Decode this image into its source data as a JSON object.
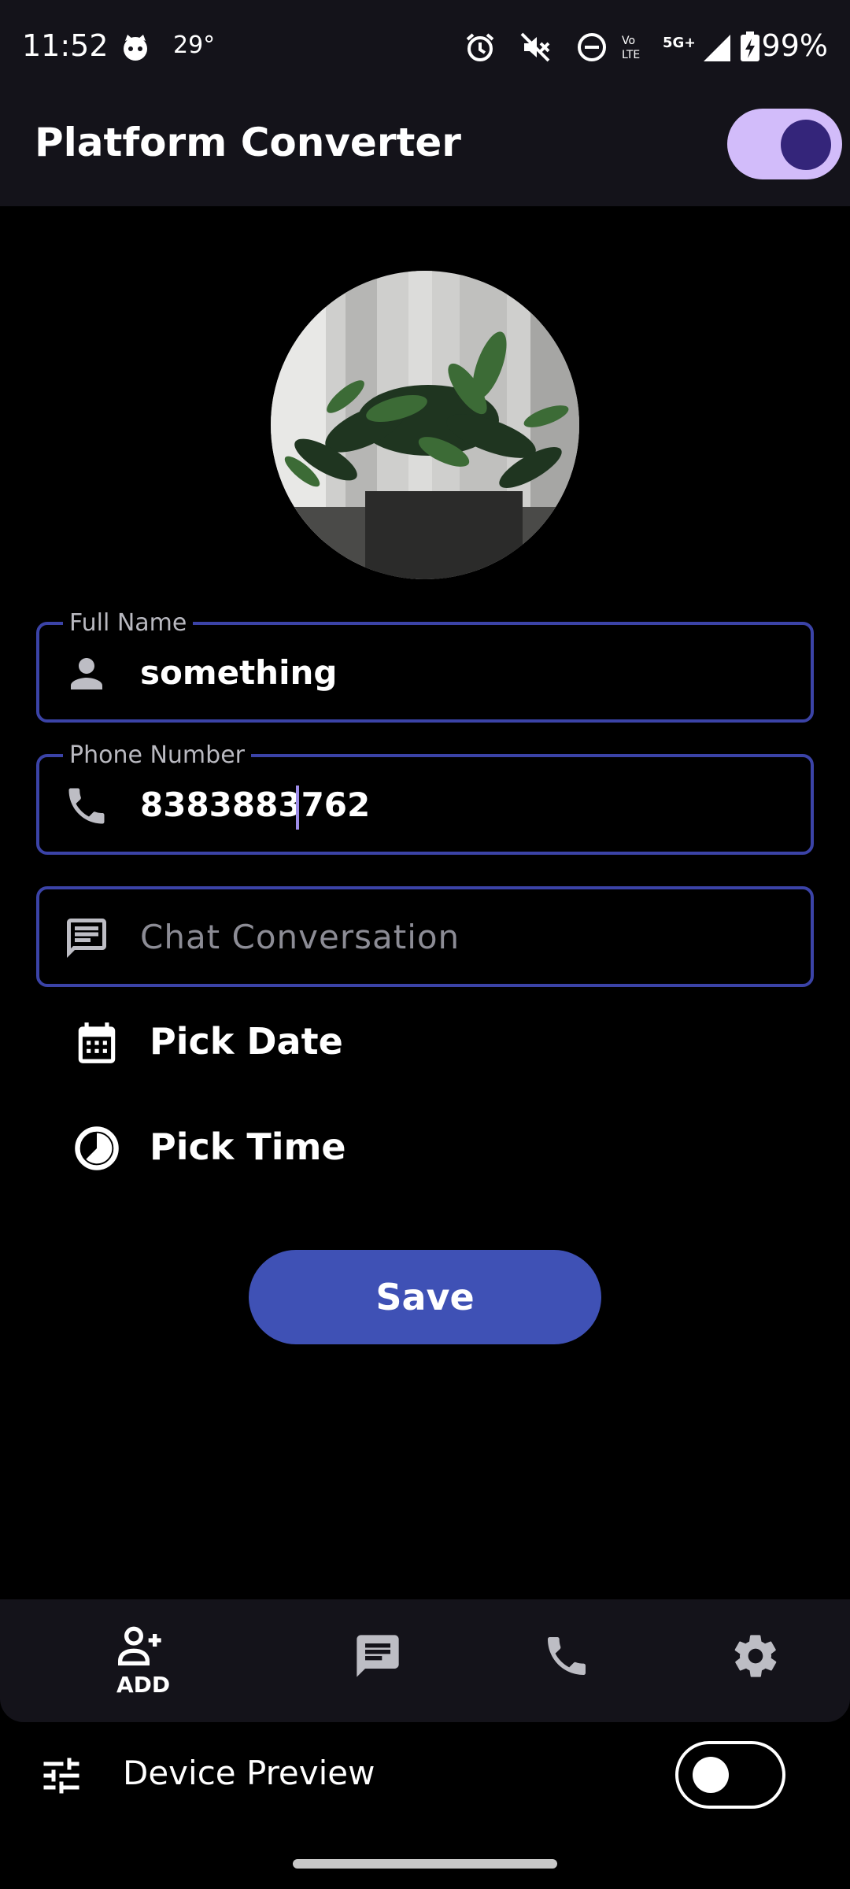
{
  "status_bar": {
    "time": "11:52",
    "temperature": "29°",
    "battery": "99%",
    "icons": [
      "cat-face-icon",
      "alarm-icon",
      "mute-icon",
      "dnd-icon",
      "volte-icon",
      "5g-icon",
      "signal-icon",
      "battery-charging-icon"
    ]
  },
  "app_bar": {
    "title": "Platform Converter",
    "theme_toggle_on": true
  },
  "form": {
    "full_name": {
      "label": "Full Name",
      "value": "something",
      "icon": "person-icon"
    },
    "phone": {
      "label": "Phone Number",
      "value": "8383883762",
      "icon": "phone-icon"
    },
    "chat": {
      "placeholder": "Chat Conversation",
      "icon": "chat-icon"
    },
    "pick_date": {
      "label": "Pick Date",
      "icon": "calendar-icon"
    },
    "pick_time": {
      "label": "Pick Time",
      "icon": "clock-icon"
    },
    "save_label": "Save"
  },
  "bottom_nav": {
    "items": [
      {
        "label": "ADD",
        "icon": "person-add-icon",
        "active": true
      },
      {
        "label": "",
        "icon": "chat-icon",
        "active": false
      },
      {
        "label": "",
        "icon": "phone-icon",
        "active": false
      },
      {
        "label": "",
        "icon": "settings-icon",
        "active": false
      }
    ]
  },
  "device_preview": {
    "label": "Device Preview",
    "toggle_on": false,
    "icon": "tune-icon"
  },
  "colors": {
    "background": "#000000",
    "bar": "#14131a",
    "accent": "#3f51b5",
    "field_border": "#3b43a7",
    "toggle_track": "#d2bcfa",
    "toggle_knob": "#34257a"
  }
}
